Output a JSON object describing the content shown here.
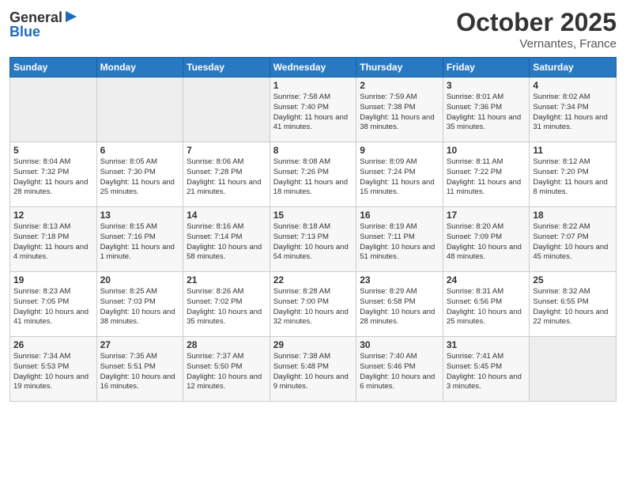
{
  "header": {
    "logo_general": "General",
    "logo_blue": "Blue",
    "month": "October 2025",
    "location": "Vernantes, France"
  },
  "weekdays": [
    "Sunday",
    "Monday",
    "Tuesday",
    "Wednesday",
    "Thursday",
    "Friday",
    "Saturday"
  ],
  "weeks": [
    [
      {
        "day": "",
        "info": ""
      },
      {
        "day": "",
        "info": ""
      },
      {
        "day": "",
        "info": ""
      },
      {
        "day": "1",
        "info": "Sunrise: 7:58 AM\nSunset: 7:40 PM\nDaylight: 11 hours and 41 minutes."
      },
      {
        "day": "2",
        "info": "Sunrise: 7:59 AM\nSunset: 7:38 PM\nDaylight: 11 hours and 38 minutes."
      },
      {
        "day": "3",
        "info": "Sunrise: 8:01 AM\nSunset: 7:36 PM\nDaylight: 11 hours and 35 minutes."
      },
      {
        "day": "4",
        "info": "Sunrise: 8:02 AM\nSunset: 7:34 PM\nDaylight: 11 hours and 31 minutes."
      }
    ],
    [
      {
        "day": "5",
        "info": "Sunrise: 8:04 AM\nSunset: 7:32 PM\nDaylight: 11 hours and 28 minutes."
      },
      {
        "day": "6",
        "info": "Sunrise: 8:05 AM\nSunset: 7:30 PM\nDaylight: 11 hours and 25 minutes."
      },
      {
        "day": "7",
        "info": "Sunrise: 8:06 AM\nSunset: 7:28 PM\nDaylight: 11 hours and 21 minutes."
      },
      {
        "day": "8",
        "info": "Sunrise: 8:08 AM\nSunset: 7:26 PM\nDaylight: 11 hours and 18 minutes."
      },
      {
        "day": "9",
        "info": "Sunrise: 8:09 AM\nSunset: 7:24 PM\nDaylight: 11 hours and 15 minutes."
      },
      {
        "day": "10",
        "info": "Sunrise: 8:11 AM\nSunset: 7:22 PM\nDaylight: 11 hours and 11 minutes."
      },
      {
        "day": "11",
        "info": "Sunrise: 8:12 AM\nSunset: 7:20 PM\nDaylight: 11 hours and 8 minutes."
      }
    ],
    [
      {
        "day": "12",
        "info": "Sunrise: 8:13 AM\nSunset: 7:18 PM\nDaylight: 11 hours and 4 minutes."
      },
      {
        "day": "13",
        "info": "Sunrise: 8:15 AM\nSunset: 7:16 PM\nDaylight: 11 hours and 1 minute."
      },
      {
        "day": "14",
        "info": "Sunrise: 8:16 AM\nSunset: 7:14 PM\nDaylight: 10 hours and 58 minutes."
      },
      {
        "day": "15",
        "info": "Sunrise: 8:18 AM\nSunset: 7:13 PM\nDaylight: 10 hours and 54 minutes."
      },
      {
        "day": "16",
        "info": "Sunrise: 8:19 AM\nSunset: 7:11 PM\nDaylight: 10 hours and 51 minutes."
      },
      {
        "day": "17",
        "info": "Sunrise: 8:20 AM\nSunset: 7:09 PM\nDaylight: 10 hours and 48 minutes."
      },
      {
        "day": "18",
        "info": "Sunrise: 8:22 AM\nSunset: 7:07 PM\nDaylight: 10 hours and 45 minutes."
      }
    ],
    [
      {
        "day": "19",
        "info": "Sunrise: 8:23 AM\nSunset: 7:05 PM\nDaylight: 10 hours and 41 minutes."
      },
      {
        "day": "20",
        "info": "Sunrise: 8:25 AM\nSunset: 7:03 PM\nDaylight: 10 hours and 38 minutes."
      },
      {
        "day": "21",
        "info": "Sunrise: 8:26 AM\nSunset: 7:02 PM\nDaylight: 10 hours and 35 minutes."
      },
      {
        "day": "22",
        "info": "Sunrise: 8:28 AM\nSunset: 7:00 PM\nDaylight: 10 hours and 32 minutes."
      },
      {
        "day": "23",
        "info": "Sunrise: 8:29 AM\nSunset: 6:58 PM\nDaylight: 10 hours and 28 minutes."
      },
      {
        "day": "24",
        "info": "Sunrise: 8:31 AM\nSunset: 6:56 PM\nDaylight: 10 hours and 25 minutes."
      },
      {
        "day": "25",
        "info": "Sunrise: 8:32 AM\nSunset: 6:55 PM\nDaylight: 10 hours and 22 minutes."
      }
    ],
    [
      {
        "day": "26",
        "info": "Sunrise: 7:34 AM\nSunset: 5:53 PM\nDaylight: 10 hours and 19 minutes."
      },
      {
        "day": "27",
        "info": "Sunrise: 7:35 AM\nSunset: 5:51 PM\nDaylight: 10 hours and 16 minutes."
      },
      {
        "day": "28",
        "info": "Sunrise: 7:37 AM\nSunset: 5:50 PM\nDaylight: 10 hours and 12 minutes."
      },
      {
        "day": "29",
        "info": "Sunrise: 7:38 AM\nSunset: 5:48 PM\nDaylight: 10 hours and 9 minutes."
      },
      {
        "day": "30",
        "info": "Sunrise: 7:40 AM\nSunset: 5:46 PM\nDaylight: 10 hours and 6 minutes."
      },
      {
        "day": "31",
        "info": "Sunrise: 7:41 AM\nSunset: 5:45 PM\nDaylight: 10 hours and 3 minutes."
      },
      {
        "day": "",
        "info": ""
      }
    ]
  ]
}
